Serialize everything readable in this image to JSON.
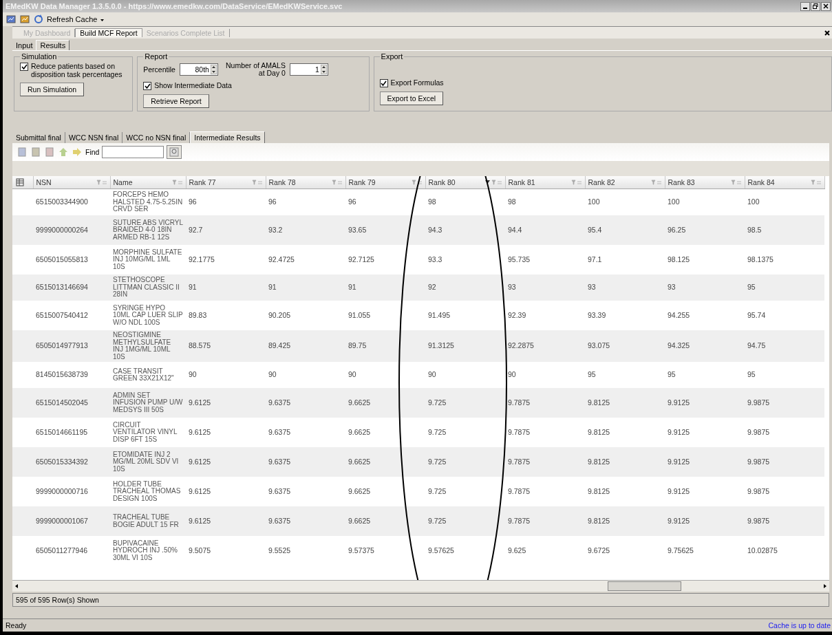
{
  "window": {
    "title": "EMedKW Data Manager 1.3.5.0.0 - https://www.emedkw.com/DataService/EMedKWService.svc"
  },
  "toolbar": {
    "refresh_label": "Refresh Cache"
  },
  "doc_tabs": [
    {
      "label": "My Dashboard",
      "selected": false,
      "disabled": true
    },
    {
      "label": "Build MCF Report",
      "selected": true,
      "disabled": false
    },
    {
      "label": "Scenarios Complete List",
      "selected": false,
      "disabled": true
    }
  ],
  "view_tabs": [
    {
      "label": "Input",
      "selected": false
    },
    {
      "label": "Results",
      "selected": true
    }
  ],
  "simulation": {
    "title": "Simulation",
    "checkbox": {
      "label": "Reduce patients based on disposition task percentages",
      "checked": true
    },
    "button": "Run Simulation"
  },
  "report": {
    "title": "Report",
    "percentile_label": "Percentile",
    "percentile": "80th",
    "amals_label": "Number of AMALS at Day 0",
    "amals": "1",
    "checkbox": {
      "label": "Show Intermediate Data",
      "checked": true
    },
    "button": "Retrieve Report"
  },
  "export": {
    "title": "Export",
    "checkbox": {
      "label": "Export Formulas",
      "checked": true
    },
    "button": "Export to Excel"
  },
  "result_tabs": [
    {
      "label": "Submittal final",
      "selected": false
    },
    {
      "label": "WCC NSN final",
      "selected": false
    },
    {
      "label": "WCC no NSN final",
      "selected": false
    },
    {
      "label": "Intermediate Results",
      "selected": true
    }
  ],
  "find": {
    "label": "Find"
  },
  "table": {
    "columns": [
      {
        "label": "NSN",
        "sorted": false
      },
      {
        "label": "Name",
        "sorted": false
      },
      {
        "label": "Rank 77",
        "sorted": false
      },
      {
        "label": "Rank 78",
        "sorted": false
      },
      {
        "label": "Rank 79",
        "sorted": false
      },
      {
        "label": "Rank 80",
        "sorted": true
      },
      {
        "label": "Rank 81",
        "sorted": false
      },
      {
        "label": "Rank 82",
        "sorted": false
      },
      {
        "label": "Rank 83",
        "sorted": false
      },
      {
        "label": "Rank 84",
        "sorted": false
      }
    ],
    "rows": [
      [
        "6515003344900",
        "FORCEPS HEMO HALSTED 4.75-5.25IN CRVD SER",
        "96",
        "96",
        "96",
        "98",
        "98",
        "100",
        "100",
        "100"
      ],
      [
        "9999000000264",
        "SUTURE ABS VICRYL BRAIDED 4-0 18IN ARMED RB-1 12S",
        "92.7",
        "93.2",
        "93.65",
        "94.3",
        "94.4",
        "95.4",
        "96.25",
        "98.5"
      ],
      [
        "6505015055813",
        "MORPHINE SULFATE INJ 10MG/ML 1ML 10S",
        "92.1775",
        "92.4725",
        "92.7125",
        "93.3",
        "95.735",
        "97.1",
        "98.125",
        "98.1375"
      ],
      [
        "6515013146694",
        "STETHOSCOPE LITTMAN CLASSIC II 28IN",
        "91",
        "91",
        "91",
        "92",
        "93",
        "93",
        "93",
        "95"
      ],
      [
        "6515007540412",
        "SYRINGE HYPO 10ML CAP LUER SLIP W/O NDL 100S",
        "89.83",
        "90.205",
        "91.055",
        "91.495",
        "92.39",
        "93.39",
        "94.255",
        "95.74"
      ],
      [
        "6505014977913",
        "NEOSTIGMINE METHYLSULFATE INJ 1MG/ML 10ML 10S",
        "88.575",
        "89.425",
        "89.75",
        "91.3125",
        "92.2875",
        "93.075",
        "94.325",
        "94.75"
      ],
      [
        "8145015638739",
        "CASE TRANSIT GREEN 33X21X12\"",
        "90",
        "90",
        "90",
        "90",
        "90",
        "95",
        "95",
        "95"
      ],
      [
        "6515014502045",
        "ADMIN SET INFUSION PUMP U/W MEDSYS III 50S",
        "9.6125",
        "9.6375",
        "9.6625",
        "9.725",
        "9.7875",
        "9.8125",
        "9.9125",
        "9.9875"
      ],
      [
        "6515014661195",
        "CIRCUIT VENTILATOR VINYL DISP 6FT 15S",
        "9.6125",
        "9.6375",
        "9.6625",
        "9.725",
        "9.7875",
        "9.8125",
        "9.9125",
        "9.9875"
      ],
      [
        "6505015334392",
        "ETOMIDATE INJ 2 MG/ML 20ML SDV VI 10S",
        "9.6125",
        "9.6375",
        "9.6625",
        "9.725",
        "9.7875",
        "9.8125",
        "9.9125",
        "9.9875"
      ],
      [
        "9999000000716",
        "HOLDER TUBE TRACHEAL THOMAS DESIGN 100S",
        "9.6125",
        "9.6375",
        "9.6625",
        "9.725",
        "9.7875",
        "9.8125",
        "9.9125",
        "9.9875"
      ],
      [
        "9999000001067",
        "TRACHEAL TUBE BOGIE ADULT 15 FR",
        "9.6125",
        "9.6375",
        "9.6625",
        "9.725",
        "9.7875",
        "9.8125",
        "9.9125",
        "9.9875"
      ],
      [
        "6505011277946",
        "BUPIVACAINE HYDROCH INJ .50% 30ML VI 10S",
        "9.5075",
        "9.5525",
        "9.57375",
        "9.57625",
        "9.625",
        "9.6725",
        "9.75625",
        "10.02875"
      ]
    ]
  },
  "row_count": "595 of 595 Row(s) Shown",
  "status_bar": {
    "state": "Ready",
    "cache": "Cache is up to date"
  }
}
